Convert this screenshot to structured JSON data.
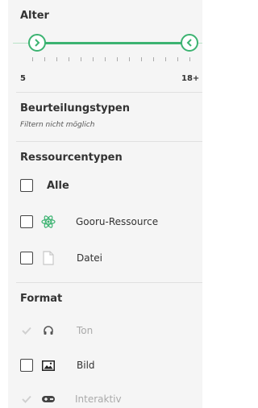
{
  "age": {
    "title": "Alter",
    "min_label": "5",
    "max_label": "18+"
  },
  "assessment": {
    "title": "Beurteilungstypen",
    "note": "Filtern nicht möglich"
  },
  "resources": {
    "title": "Ressourcentypen",
    "items": [
      {
        "label": "Alle",
        "checked": false
      },
      {
        "label": "Gooru-Ressource",
        "checked": false,
        "icon": "atom-icon"
      },
      {
        "label": "Datei",
        "checked": false,
        "icon": "file-icon"
      }
    ]
  },
  "format": {
    "title": "Format",
    "items": [
      {
        "label": "Ton",
        "checked": true,
        "disabled": true,
        "icon": "headphones-icon"
      },
      {
        "label": "Bild",
        "checked": false,
        "icon": "image-icon"
      },
      {
        "label": "Interaktiv",
        "checked": true,
        "disabled": true,
        "icon": "gamepad-icon"
      }
    ]
  },
  "colors": {
    "accent": "#3cb371",
    "panel_bg": "#f5f5f5"
  }
}
